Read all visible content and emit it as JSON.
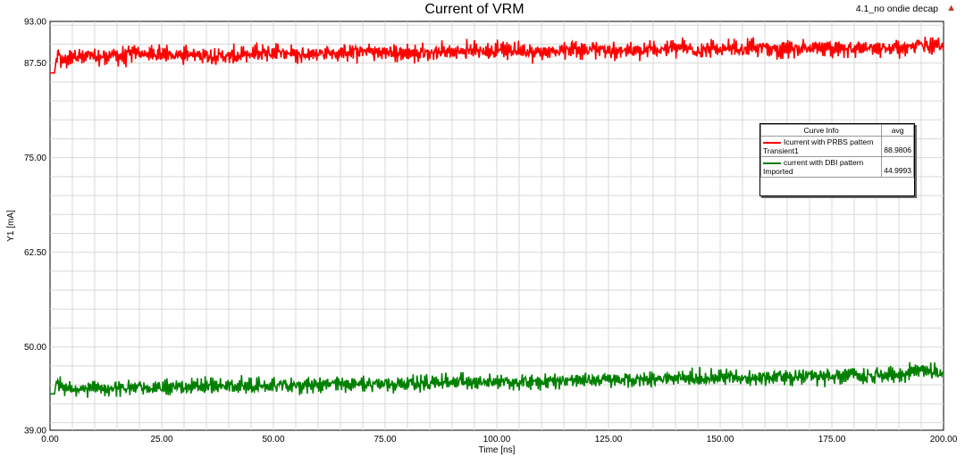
{
  "corner": {
    "label": "4.1_no ondie decap",
    "icon": "ansys-logo-icon"
  },
  "legend": {
    "header_info": "Curve Info",
    "header_avg": "avg",
    "rows": [
      {
        "name": "Icurrent with PRBS pattern",
        "source": "Transient1",
        "avg": "88.9806",
        "color": "#ff0000"
      },
      {
        "name": "current with DBI pattern",
        "source": "Imported",
        "avg": "44.9993",
        "color": "#008000"
      }
    ]
  },
  "chart_data": {
    "type": "line",
    "title": "Current of VRM",
    "xlabel": "Time [ns]",
    "ylabel": "Y1 [mA]",
    "xlim": [
      0,
      200
    ],
    "ylim": [
      39,
      93
    ],
    "xticks": [
      "0.00",
      "25.00",
      "50.00",
      "75.00",
      "100.00",
      "125.00",
      "150.00",
      "175.00",
      "200.00"
    ],
    "yticks": [
      "39.00",
      "50.00",
      "62.50",
      "75.00",
      "87.50",
      "93.00"
    ],
    "ytick_values": [
      39,
      50,
      62.5,
      75,
      87.5,
      93
    ],
    "grid": true,
    "legend_position": "right",
    "series": [
      {
        "name": "Icurrent with PRBS pattern",
        "color": "#ff0000",
        "avg": 88.9806,
        "x": [
          0,
          1,
          1.5,
          3,
          5,
          10,
          20,
          30,
          40,
          50,
          60,
          70,
          80,
          90,
          100,
          110,
          120,
          130,
          140,
          150,
          160,
          170,
          180,
          190,
          195,
          200
        ],
        "y": [
          86.2,
          86.2,
          88.5,
          87.8,
          88.6,
          88.2,
          88.8,
          88.6,
          88.4,
          88.9,
          88.7,
          89.0,
          88.8,
          89.1,
          89.2,
          89.0,
          89.3,
          89.1,
          89.4,
          89.2,
          89.5,
          89.3,
          89.6,
          89.4,
          90.0,
          89.5
        ]
      },
      {
        "name": "current with DBI pattern",
        "color": "#008000",
        "avg": 44.9993,
        "x": [
          0,
          1,
          1.5,
          3,
          5,
          10,
          20,
          30,
          40,
          50,
          60,
          70,
          80,
          90,
          100,
          110,
          120,
          130,
          140,
          150,
          160,
          170,
          180,
          190,
          195,
          200
        ],
        "y": [
          43.8,
          43.8,
          45.8,
          44.3,
          44.6,
          44.5,
          44.6,
          44.7,
          44.8,
          44.9,
          45.0,
          45.1,
          45.2,
          45.3,
          45.4,
          45.5,
          45.6,
          45.7,
          45.8,
          45.9,
          46.0,
          46.1,
          46.2,
          46.3,
          47.0,
          46.4
        ]
      }
    ]
  }
}
